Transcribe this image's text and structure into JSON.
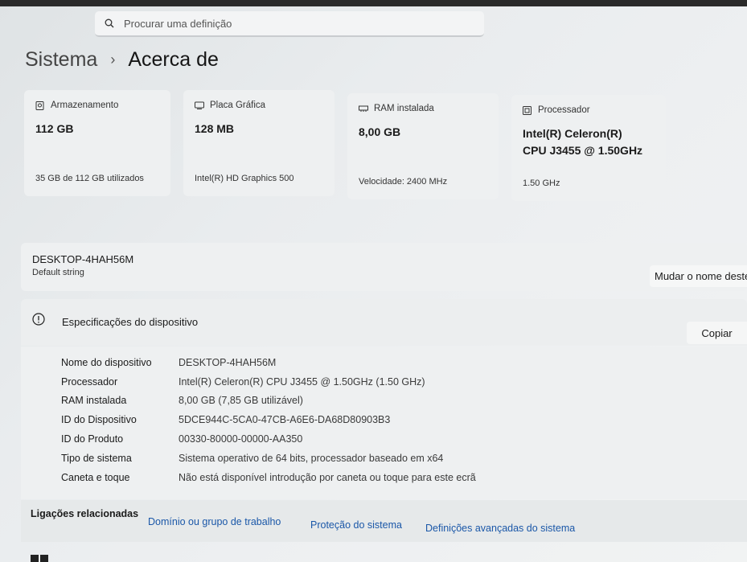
{
  "search": {
    "placeholder": "Procurar uma definição",
    "icon": "search-icon"
  },
  "breadcrumb": {
    "parent": "Sistema",
    "separator": "›",
    "current": "Acerca de"
  },
  "cards": [
    {
      "icon": "storage-icon",
      "title": "Armazenamento",
      "value": "112 GB",
      "value2": "",
      "sub": "35 GB de 112 GB utilizados"
    },
    {
      "icon": "gpu-icon",
      "title": "Placa Gráfica",
      "value": "128 MB",
      "value2": "",
      "sub": "Intel(R) HD Graphics 500"
    },
    {
      "icon": "ram-icon",
      "title": "RAM instalada",
      "value": "8,00 GB",
      "value2": "",
      "sub": "Velocidade: 2400 MHz"
    },
    {
      "icon": "processor-icon",
      "title": "Processador",
      "value": "Intel(R) Celeron(R)",
      "value2": "CPU J3455 @ 1.50GHz",
      "sub": "1.50 GHz"
    }
  ],
  "device": {
    "name": "DESKTOP-4HAH56M",
    "model": "Default string",
    "rename_label": "Mudar o nome deste PC"
  },
  "specs": {
    "title": "Especificações do dispositivo",
    "copy_label": "Copiar",
    "rows": [
      {
        "key": "Nome do dispositivo",
        "value": "DESKTOP-4HAH56M"
      },
      {
        "key": "Processador",
        "value": "Intel(R) Celeron(R) CPU J3455 @ 1.50GHz (1.50 GHz)"
      },
      {
        "key": "RAM instalada",
        "value": "8,00 GB (7,85 GB utilizável)"
      },
      {
        "key": "ID do Dispositivo",
        "value": "5DCE944C-5CA0-47CB-A6E6-DA68D80903B3"
      },
      {
        "key": "ID do Produto",
        "value": "00330-80000-00000-AA350"
      },
      {
        "key": "Tipo de sistema",
        "value": "Sistema operativo de 64 bits, processador baseado em x64"
      },
      {
        "key": "Caneta e toque",
        "value": "Não está disponível introdução por caneta ou toque para este ecrã"
      }
    ]
  },
  "related": {
    "label": "Ligações relacionadas",
    "links": [
      "Domínio ou grupo de trabalho",
      "Proteção do sistema",
      "Definições avançadas do sistema"
    ]
  },
  "colors": {
    "accent_link": "#1a57a8",
    "card_bg": "#eef0f1"
  }
}
